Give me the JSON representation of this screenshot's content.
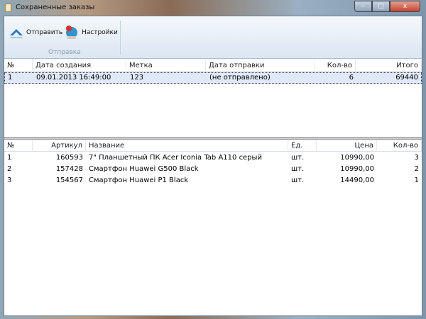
{
  "window": {
    "title": "Сохраненные заказы",
    "min": "–",
    "max": "□",
    "close": "x"
  },
  "ribbon": {
    "send_label": "Отправить",
    "settings_label": "Настройки",
    "group_label": "Отправка"
  },
  "orders": {
    "columns": [
      "№",
      "Дата создания",
      "Метка",
      "Дата отправки",
      "Кол-во",
      "Итого"
    ],
    "rows": [
      {
        "n": "1",
        "created": "09.01.2013 16:49:00",
        "tag": "123",
        "sent": "(не отправлено)",
        "qty": "6",
        "total": "69440"
      }
    ]
  },
  "items": {
    "columns": [
      "№",
      "Артикул",
      "Название",
      "Ед.",
      "Цена",
      "Кол-во"
    ],
    "rows": [
      {
        "n": "1",
        "sku": "160593",
        "name": "7\" Планшетный ПК Acer Iconia Tab A110 серый",
        "unit": "шт.",
        "price": "10990,00",
        "qty": "3"
      },
      {
        "n": "2",
        "sku": "157428",
        "name": "Смартфон Huawei G500 Black",
        "unit": "шт.",
        "price": "10990,00",
        "qty": "2"
      },
      {
        "n": "3",
        "sku": "154567",
        "name": "Смартфон Huawei P1 Black",
        "unit": "шт.",
        "price": "14490,00",
        "qty": "1"
      }
    ]
  }
}
